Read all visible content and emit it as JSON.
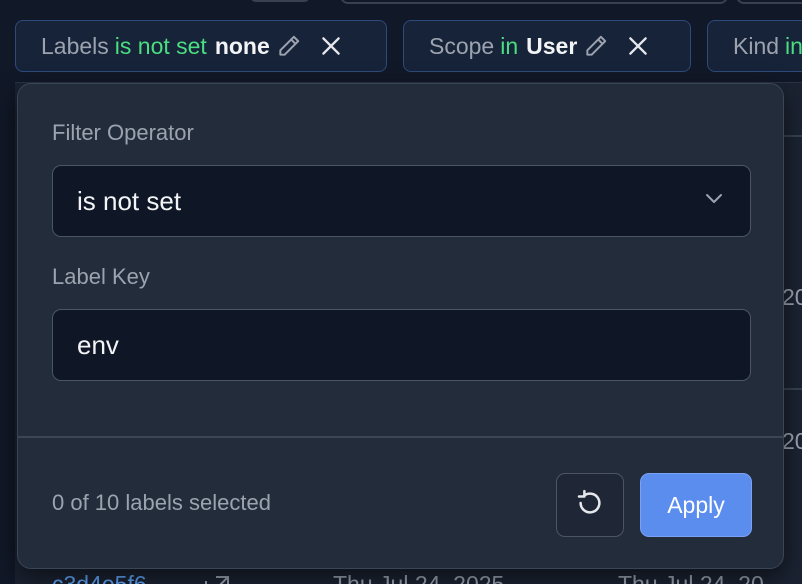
{
  "chips": [
    {
      "field": "Labels",
      "operator": "is not set",
      "value": "none"
    },
    {
      "field": "Scope",
      "operator": "in",
      "value": "User"
    },
    {
      "field": "Kind",
      "operator": "in",
      "value": ""
    }
  ],
  "background": {
    "row_text_1": "20",
    "row_text_2": "20",
    "bottom_link": "c3d4e5f6",
    "bottom_date_1": "Thu Jul 24, 2025",
    "bottom_date_2": "Thu Jul 24, 20"
  },
  "popover": {
    "operator_label": "Filter Operator",
    "operator_value": "is not set",
    "key_label": "Label Key",
    "key_value": "env",
    "selection_count": "0 of 10 labels selected",
    "apply_label": "Apply"
  },
  "colors": {
    "accent": "#5b8def",
    "operator_green": "#4ade80",
    "chip_border": "#2e4a7a",
    "popover_bg": "#232c3b",
    "page_bg": "#111827"
  },
  "icons": [
    "pencil-icon",
    "close-icon",
    "chevron-down-icon",
    "reset-icon",
    "external-link-icon"
  ]
}
